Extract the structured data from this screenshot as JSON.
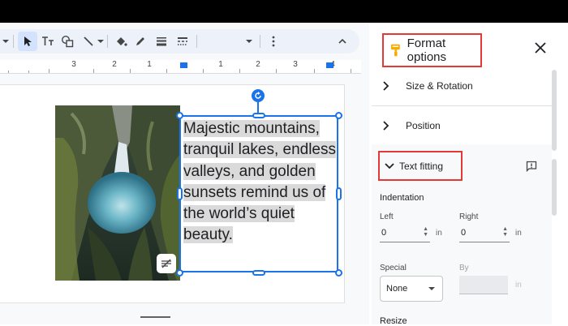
{
  "toolbar": {
    "icons": [
      "chevron-down-icon",
      "cursor-icon",
      "text-box-icon",
      "shapes-icon",
      "line-icon",
      "fill-color-icon",
      "pen-icon",
      "line-weight-icon",
      "line-dash-icon",
      "chevron-down-icon",
      "more-icon",
      "chevron-up-icon"
    ]
  },
  "ruler": {
    "numbers": [
      "3",
      "2",
      "1",
      "1",
      "2",
      "3",
      "4"
    ]
  },
  "textbox": {
    "lines": [
      "Majestic mountains,",
      "tranquil lakes, endless",
      "valleys, and golden",
      "sunsets remind us of",
      "the world’s quiet",
      "beauty."
    ]
  },
  "panel": {
    "title": "Format options",
    "sections": [
      {
        "label": "Size & Rotation",
        "expanded": false
      },
      {
        "label": "Position",
        "expanded": false
      },
      {
        "label": "Text fitting",
        "expanded": true
      }
    ],
    "indentation": {
      "heading": "Indentation",
      "left_label": "Left",
      "left_value": "0",
      "right_label": "Right",
      "right_value": "0",
      "unit": "in",
      "special_label": "Special",
      "special_value": "None",
      "by_label": "By",
      "by_unit": "in"
    },
    "next_heading": "Resize"
  },
  "colors": {
    "accent": "#1a73e8",
    "highlight_box": "#e53935",
    "selection_bg": "#dadada"
  }
}
